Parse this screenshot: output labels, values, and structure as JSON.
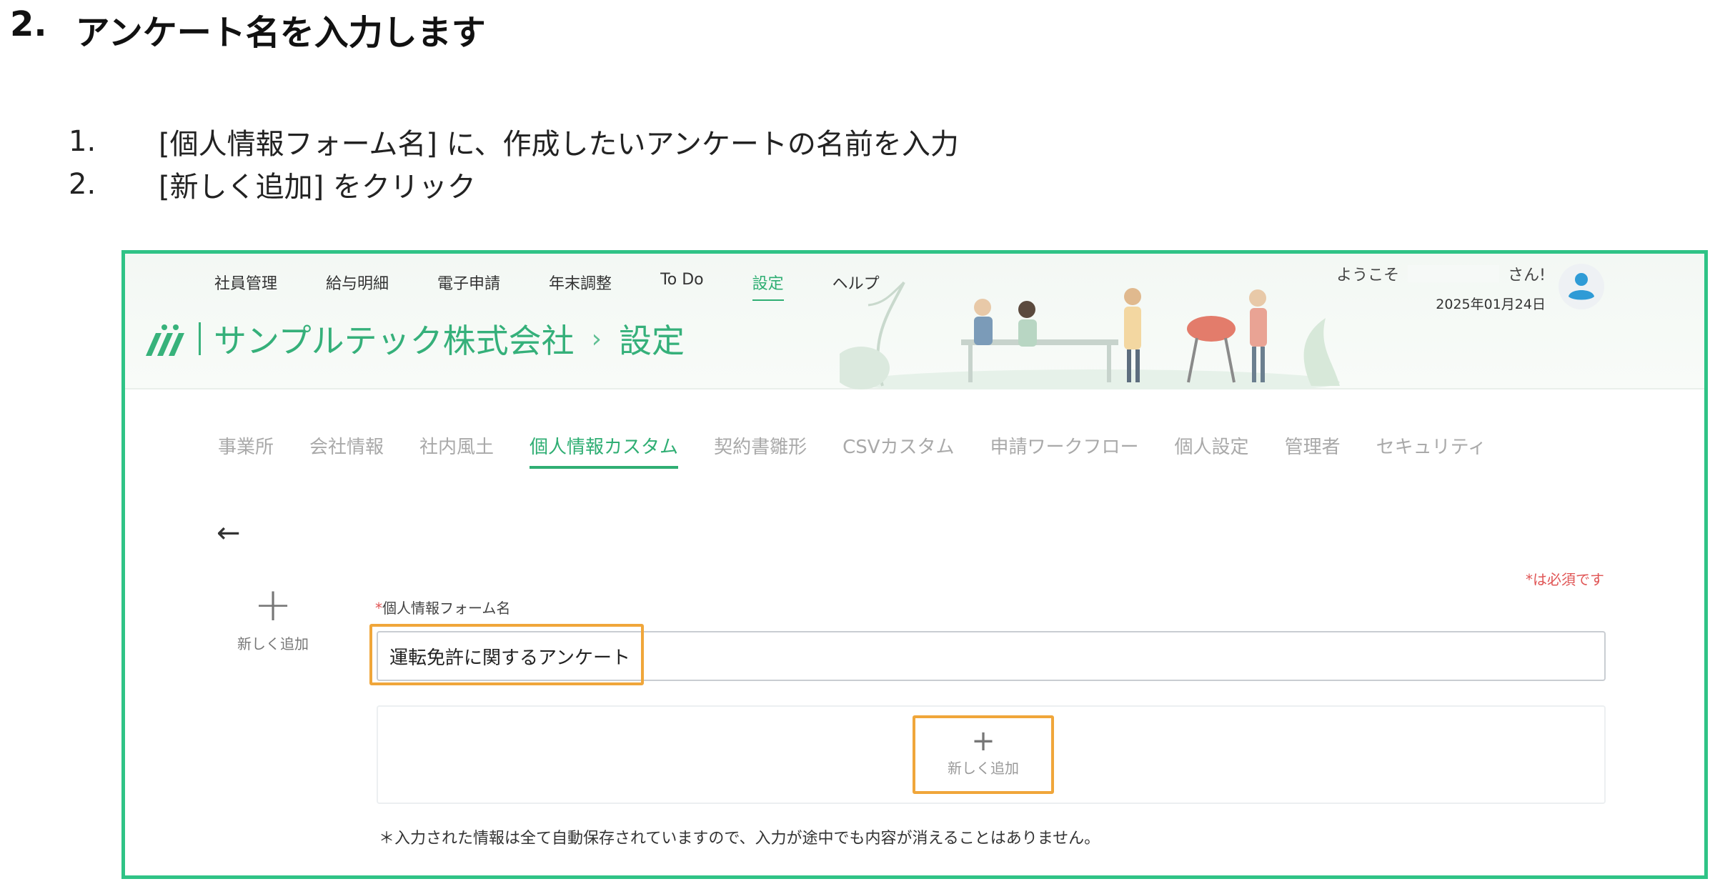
{
  "doc": {
    "heading_number": "2.",
    "heading_text": "アンケート名を入力します",
    "steps": [
      {
        "num": "1.",
        "text": "[個人情報フォーム名] に、作成したいアンケートの名前を入力"
      },
      {
        "num": "2.",
        "text": "[新しく追加] をクリック"
      }
    ]
  },
  "app": {
    "top_nav": [
      "社員管理",
      "給与明細",
      "電子申請",
      "年末調整",
      "To Do",
      "設定",
      "ヘルプ"
    ],
    "top_nav_active": "設定",
    "company_name": "サンプルテック株式会社",
    "breadcrumb_sep": "›",
    "page": "設定",
    "welcome_prefix": "ようこそ",
    "welcome_suffix": "さん!",
    "date": "2025年01月24日",
    "sub_tabs": [
      "事業所",
      "会社情報",
      "社内風土",
      "個人情報カスタム",
      "契約書雛形",
      "CSVカスタム",
      "申請ワークフロー",
      "個人設定",
      "管理者",
      "セキュリティ"
    ],
    "sub_tab_active": "個人情報カスタム",
    "back_arrow": "←",
    "side_add_plus": "+",
    "side_add_label": "新しく追加",
    "required_note": "*は必須です",
    "field_label_asterisk": "*",
    "field_label": "個人情報フォーム名",
    "field_value": "運転免許に関するアンケート",
    "add_plus": "+",
    "add_label": "新しく追加",
    "autosave_note": "＊入力された情報は全て自動保存されていますので、入力が途中でも内容が消えることはありません。"
  },
  "colors": {
    "brand_green": "#2fae73",
    "frame_green": "#2fc386",
    "highlight_orange": "#f0a63a",
    "required_red": "#e05555"
  }
}
